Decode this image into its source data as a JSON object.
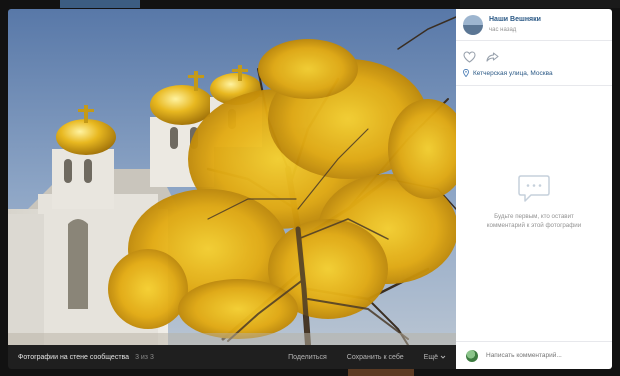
{
  "author": {
    "name": "Наши Вешняки",
    "time": "час назад"
  },
  "location": "Кетчерская улица, Москва",
  "comments": {
    "empty_text": "Будьте первым, кто оставит комментарий к этой фотографии",
    "input_placeholder": "Написать комментарий..."
  },
  "bottombar": {
    "album": "Фотографии на стене сообщества",
    "counter": "3 из 3",
    "share": "Поделиться",
    "save": "Сохранить к себе",
    "more": "Ещё"
  },
  "icons": {
    "like": "heart-icon",
    "share": "share-arrow-icon",
    "location": "map-pin-icon",
    "empty_comments": "speech-bubble-icon",
    "more": "chevron-down-icon"
  },
  "colors": {
    "link": "#2a5885",
    "muted": "#939393",
    "foliage": "#e8b416",
    "dome_gold": "#e0b020"
  }
}
